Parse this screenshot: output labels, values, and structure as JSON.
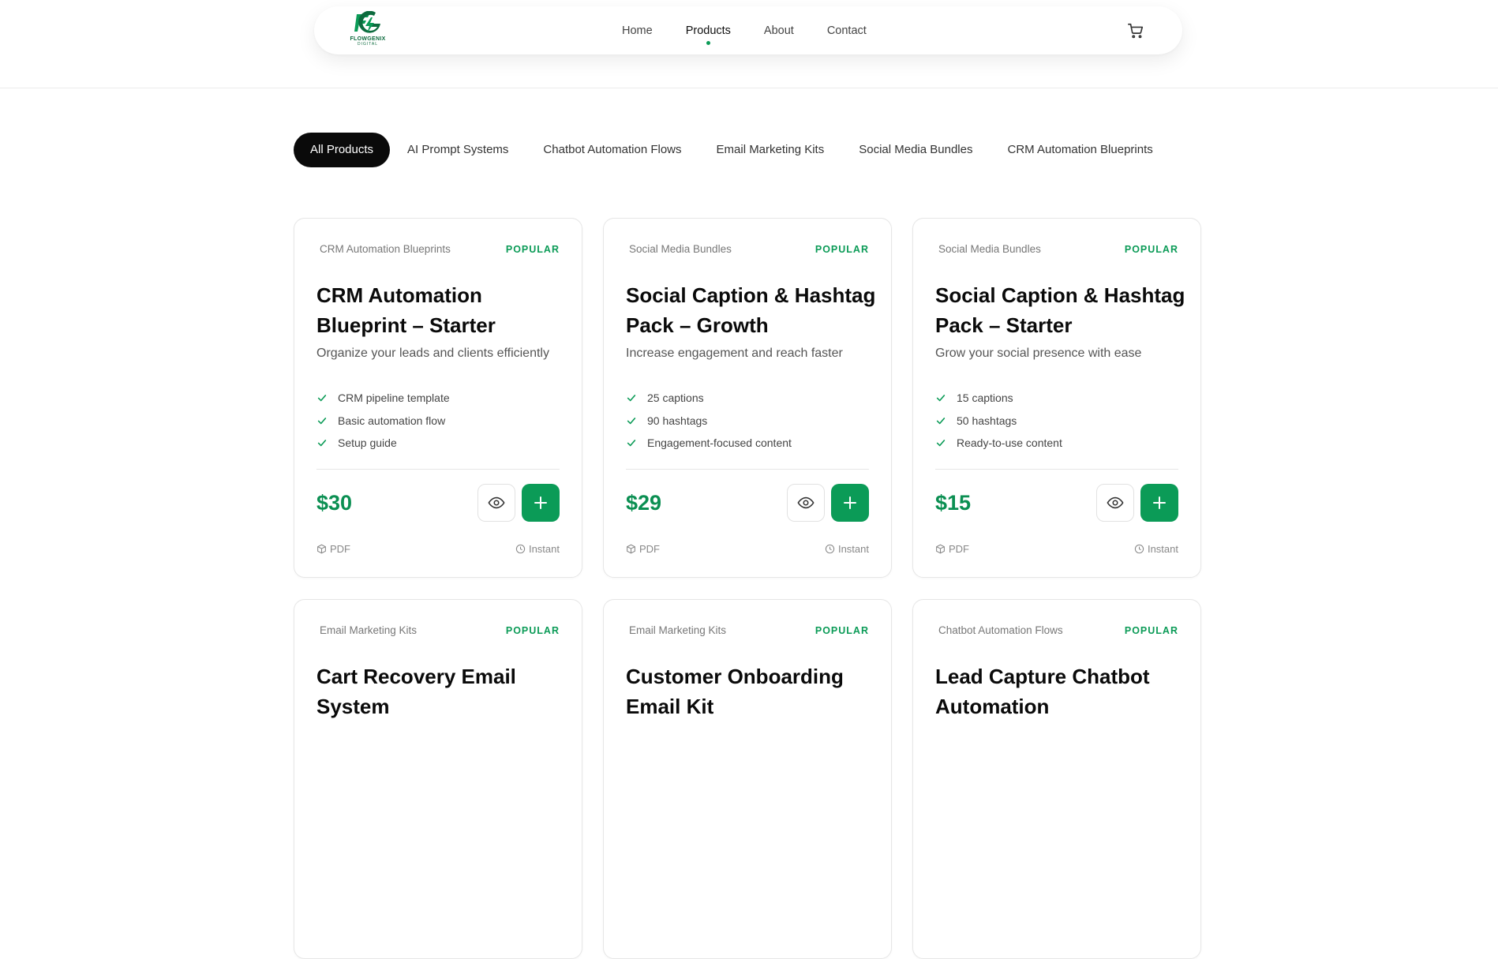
{
  "brand": {
    "name": "FLOWGENIX",
    "tagline": "DIGITAL"
  },
  "nav": {
    "links": [
      "Home",
      "Products",
      "About",
      "Contact"
    ],
    "active": "Products"
  },
  "filters": [
    "All Products",
    "AI Prompt Systems",
    "Chatbot Automation Flows",
    "Email Marketing Kits",
    "Social Media Bundles",
    "CRM Automation Blueprints"
  ],
  "products": [
    {
      "category": "CRM Automation Blueprints",
      "badge": "POPULAR",
      "title": "CRM Automation Blueprint – Starter",
      "subtitle": "Organize your leads and clients efficiently",
      "features": [
        "CRM pipeline template",
        "Basic automation flow",
        "Setup guide"
      ],
      "price": "$30",
      "format": "PDF",
      "delivery": "Instant"
    },
    {
      "category": "Social Media Bundles",
      "badge": "POPULAR",
      "title": "Social Caption & Hashtag Pack – Growth",
      "subtitle": "Increase engagement and reach faster",
      "features": [
        "25 captions",
        "90 hashtags",
        "Engagement-focused content"
      ],
      "price": "$29",
      "format": "PDF",
      "delivery": "Instant"
    },
    {
      "category": "Social Media Bundles",
      "badge": "POPULAR",
      "title": "Social Caption & Hashtag Pack – Starter",
      "subtitle": "Grow your social presence with ease",
      "features": [
        "15 captions",
        "50 hashtags",
        "Ready-to-use content"
      ],
      "price": "$15",
      "format": "PDF",
      "delivery": "Instant"
    },
    {
      "category": "Email Marketing Kits",
      "badge": "POPULAR",
      "title": "Cart Recovery Email System",
      "subtitle": "",
      "features": [],
      "price": "",
      "format": "",
      "delivery": ""
    },
    {
      "category": "Email Marketing Kits",
      "badge": "POPULAR",
      "title": "Customer Onboarding Email Kit",
      "subtitle": "",
      "features": [],
      "price": "",
      "format": "",
      "delivery": ""
    },
    {
      "category": "Chatbot Automation Flows",
      "badge": "POPULAR",
      "title": "Lead Capture Chatbot Automation",
      "subtitle": "",
      "features": [],
      "price": "",
      "format": "",
      "delivery": ""
    }
  ]
}
